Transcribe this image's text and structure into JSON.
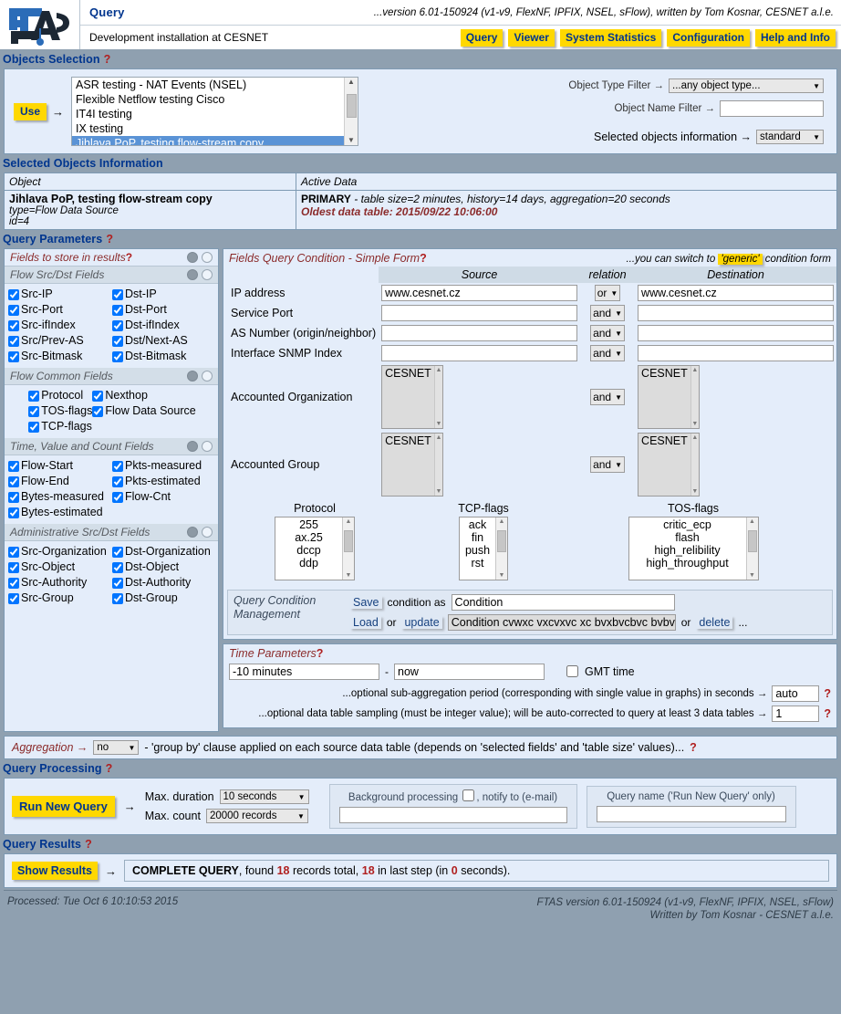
{
  "header": {
    "logo_alt": "FTAS",
    "app_title": "Query",
    "version_line": "...version 6.01-150924 (v1-v9, FlexNF, IPFIX, NSEL, sFlow), written by Tom Kosnar, CESNET a.l.e.",
    "install_line": "Development installation at CESNET",
    "nav": [
      {
        "label": "Query"
      },
      {
        "label": "Viewer"
      },
      {
        "label": "System Statistics"
      },
      {
        "label": "Configuration"
      },
      {
        "label": "Help and Info"
      }
    ]
  },
  "objects_selection": {
    "section_title": "Objects Selection",
    "help": "?",
    "use_label": "Use",
    "arrow": "→",
    "list_items": [
      {
        "label": "ASR testing - NAT Events (NSEL)",
        "selected": false
      },
      {
        "label": "Flexible Netflow testing Cisco",
        "selected": false
      },
      {
        "label": "IT4I testing",
        "selected": false
      },
      {
        "label": "IX testing",
        "selected": false
      },
      {
        "label": "Jihlava PoP, testing flow-stream copy",
        "selected": true
      }
    ],
    "object_type_filter_label": "Object Type Filter →",
    "object_type_filter_value": "...any object type...",
    "object_name_filter_label": "Object Name Filter →",
    "object_name_filter_value": "",
    "selected_objects_info_label": "Selected objects information →",
    "selected_objects_info_value": "standard"
  },
  "selected_objects_information": {
    "section_title": "Selected Objects Information",
    "columns": [
      "Object",
      "Active Data"
    ],
    "row": {
      "object_name": "Jihlava PoP, testing flow-stream copy",
      "object_type": "type=Flow Data Source",
      "object_id": "id=4",
      "active_primary": "PRIMARY",
      "active_details": "-  table size=2 minutes, history=14 days, aggregation=20 seconds",
      "oldest": "Oldest data table: 2015/09/22 10:06:00"
    }
  },
  "query_parameters": {
    "section_title": "Query Parameters",
    "help": "?",
    "fields_panel": {
      "title": "Fields to store in results",
      "help": "?",
      "groups": [
        {
          "title": "Flow Src/Dst Fields",
          "layout": "two-col",
          "items": [
            {
              "label": "Src-IP",
              "checked": true
            },
            {
              "label": "Dst-IP",
              "checked": true
            },
            {
              "label": "Src-Port",
              "checked": true
            },
            {
              "label": "Dst-Port",
              "checked": true
            },
            {
              "label": "Src-ifIndex",
              "checked": true
            },
            {
              "label": "Dst-ifIndex",
              "checked": true
            },
            {
              "label": "Src/Prev-AS",
              "checked": true
            },
            {
              "label": "Dst/Next-AS",
              "checked": true
            },
            {
              "label": "Src-Bitmask",
              "checked": true
            },
            {
              "label": "Dst-Bitmask",
              "checked": true
            }
          ]
        },
        {
          "title": "Flow Common Fields",
          "layout": "center",
          "items": [
            {
              "label": "Protocol",
              "checked": true
            },
            {
              "label": "Nexthop",
              "checked": true
            },
            {
              "label": "TOS-flags",
              "checked": true
            },
            {
              "label": "Flow Data Source",
              "checked": true
            },
            {
              "label": "TCP-flags",
              "checked": true
            }
          ]
        },
        {
          "title": "Time, Value and Count Fields",
          "layout": "two-col",
          "items": [
            {
              "label": "Flow-Start",
              "checked": true
            },
            {
              "label": "Pkts-measured",
              "checked": true
            },
            {
              "label": "Flow-End",
              "checked": true
            },
            {
              "label": "Pkts-estimated",
              "checked": true
            },
            {
              "label": "Bytes-measured",
              "checked": true
            },
            {
              "label": "Flow-Cnt",
              "checked": true
            },
            {
              "label": "Bytes-estimated",
              "checked": true
            }
          ]
        },
        {
          "title": "Administrative Src/Dst Fields",
          "layout": "two-col",
          "items": [
            {
              "label": "Src-Organization",
              "checked": true
            },
            {
              "label": "Dst-Organization",
              "checked": true
            },
            {
              "label": "Src-Object",
              "checked": true
            },
            {
              "label": "Dst-Object",
              "checked": true
            },
            {
              "label": "Src-Authority",
              "checked": true
            },
            {
              "label": "Dst-Authority",
              "checked": true
            },
            {
              "label": "Src-Group",
              "checked": true
            },
            {
              "label": "Dst-Group",
              "checked": true
            }
          ]
        }
      ]
    },
    "condition_panel": {
      "title": "Fields Query Condition - Simple Form",
      "help": "?",
      "switch_pre": "...you can switch to",
      "switch_pill": "'generic'",
      "switch_post": "condition form",
      "col_source": "Source",
      "col_relation": "relation",
      "col_destination": "Destination",
      "rows": [
        {
          "label": "IP address",
          "source": "www.cesnet.cz",
          "relation": "or",
          "destination": "www.cesnet.cz"
        },
        {
          "label": "Service Port",
          "source": "",
          "relation": "and",
          "destination": ""
        },
        {
          "label": "AS Number (origin/neighbor)",
          "source": "",
          "relation": "and",
          "destination": ""
        },
        {
          "label": "Interface SNMP Index",
          "source": "",
          "relation": "and",
          "destination": ""
        }
      ],
      "multi_rows": [
        {
          "label": "Accounted Organization",
          "source_items": [
            "CESNET"
          ],
          "relation": "and",
          "destination_items": [
            "CESNET"
          ]
        },
        {
          "label": "Accounted Group",
          "source_items": [
            "CESNET"
          ],
          "relation": "and",
          "destination_items": [
            "CESNET"
          ]
        }
      ],
      "flag_lists": [
        {
          "caption": "Protocol",
          "items": [
            "255",
            "ax.25",
            "dccp",
            "ddp"
          ]
        },
        {
          "caption": "TCP-flags",
          "items": [
            "ack",
            "fin",
            "push",
            "rst"
          ]
        },
        {
          "caption": "TOS-flags",
          "items": [
            "critic_ecp",
            "flash",
            "high_relibility",
            "high_throughput"
          ]
        }
      ]
    },
    "condition_management": {
      "title_line1": "Query Condition",
      "title_line2": "Management",
      "save_label": "Save",
      "save_text": "condition as",
      "condition_name": "Condition",
      "load_label": "Load",
      "or_text_1": "or",
      "update_label": "update",
      "saved_condition": "Condition cvwxc vxcvxvc xc bvxbvcbvc bvbvc...",
      "or_text_2": "or",
      "delete_label": "delete",
      "ellipsis": "..."
    },
    "time_parameters": {
      "title": "Time Parameters",
      "help": "?",
      "from_value": "-10 minutes",
      "dash": "-",
      "to_value": "now",
      "gmt_label": "GMT time",
      "gmt_checked": false,
      "subagg_text": "...optional sub-aggregation period (corresponding with single value in graphs) in seconds →",
      "subagg_value": "auto",
      "sampling_text": "...optional data table sampling (must be integer value); will be auto-corrected to query at least 3 data tables →",
      "sampling_value": "1",
      "help_mark": "?"
    },
    "aggregation": {
      "label": "Aggregation →",
      "value": "no",
      "text": "- 'group by' clause applied on each source data table (depends on 'selected fields' and 'table size' values)...",
      "help": "?"
    }
  },
  "query_processing": {
    "section_title": "Query Processing",
    "help": "?",
    "run_label": "Run New Query",
    "arrow": "→",
    "max_duration_label": "Max. duration",
    "max_duration_value": "10 seconds",
    "max_count_label": "Max. count",
    "max_count_value": "20000 records",
    "background_label_pre": "Background processing",
    "background_label_post": ", notify to (e-mail)",
    "background_checked": false,
    "background_email": "",
    "query_name_label": "Query name ('Run New Query' only)",
    "query_name_value": ""
  },
  "query_results": {
    "section_title": "Query Results",
    "help": "?",
    "show_label": "Show Results",
    "arrow": "→",
    "status": "COMPLETE QUERY",
    "text_1": ", found",
    "records_total": "18",
    "text_2": "records total,",
    "records_last": "18",
    "text_3": "in last step (in",
    "seconds": "0",
    "text_4": "seconds)."
  },
  "footer": {
    "processed": "Processed: Tue Oct 6 10:10:53 2015",
    "version": "FTAS version 6.01-150924 (v1-v9, FlexNF, IPFIX, NSEL, sFlow)",
    "author": "Written by Tom Kosnar - CESNET a.l.e."
  },
  "colors": {
    "accent_yellow": "#ffd800",
    "link_blue": "#16417f",
    "panel_blue": "#e4edfa",
    "page_gray": "#8fa0b0",
    "select_blue": "#5a93d6",
    "red_label": "#8b2b2b"
  }
}
